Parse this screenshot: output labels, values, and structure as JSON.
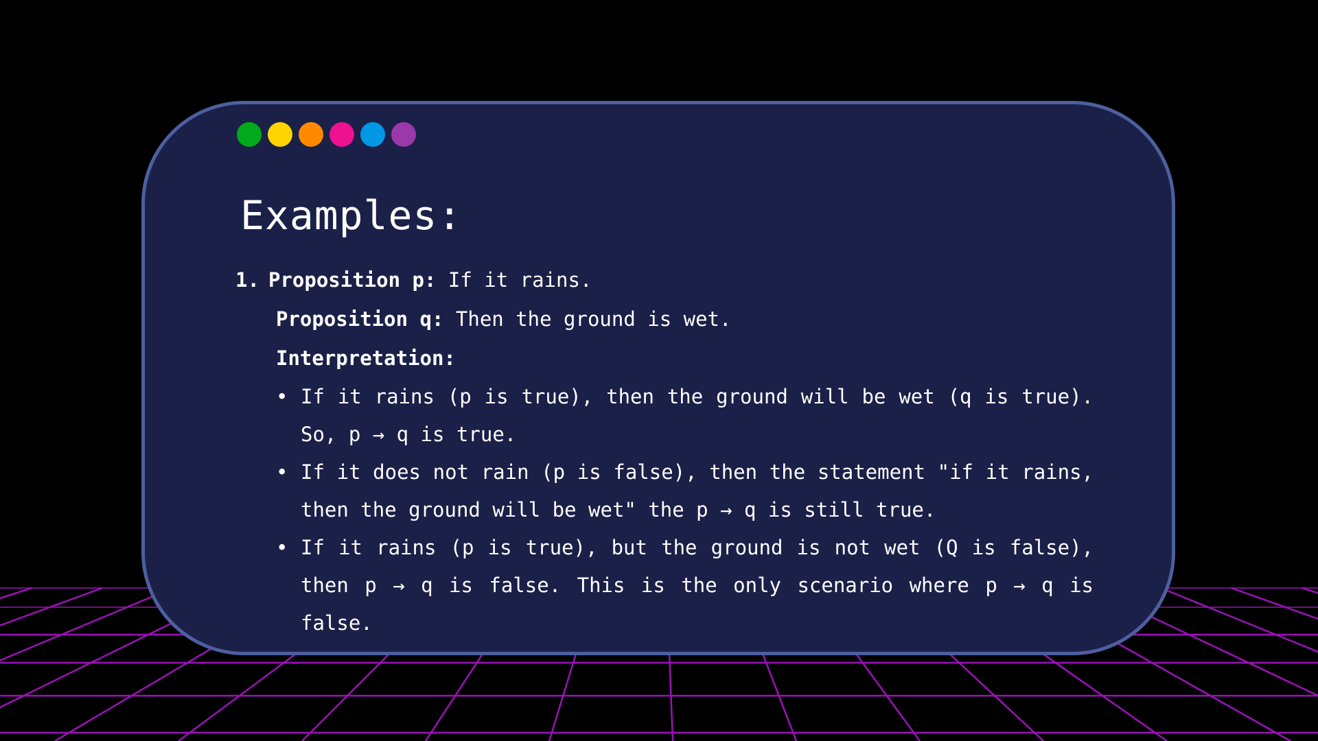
{
  "colors": {
    "background": "#000000",
    "card_fill": "#1b2048",
    "card_border": "#4d5f9f",
    "grid_line": "#9b12b8",
    "dots": [
      "#00aa1a",
      "#ffd400",
      "#ff8a00",
      "#ee1191",
      "#0098e6",
      "#9b38aa"
    ]
  },
  "slide": {
    "title": "Examples:",
    "items": [
      {
        "number": "1.",
        "proposition_p_label": "Proposition p:",
        "proposition_p_text": " If it rains.",
        "proposition_q_label": "Proposition q:",
        "proposition_q_text": " Then the ground is wet.",
        "interpretation_label": "Interpretation:",
        "bullets": [
          "If it rains (p is true), then the ground will be wet (q is true). So, p → q is true.",
          "If it does not rain (p is false), then the statement \"if it rains, then the ground will be wet\" the p → q is still true.",
          "If it rains (p is true), but the ground is not wet (Q is false), then p → q is false. This is the only scenario where p → q is false."
        ]
      }
    ],
    "bullet_symbol": "•"
  }
}
